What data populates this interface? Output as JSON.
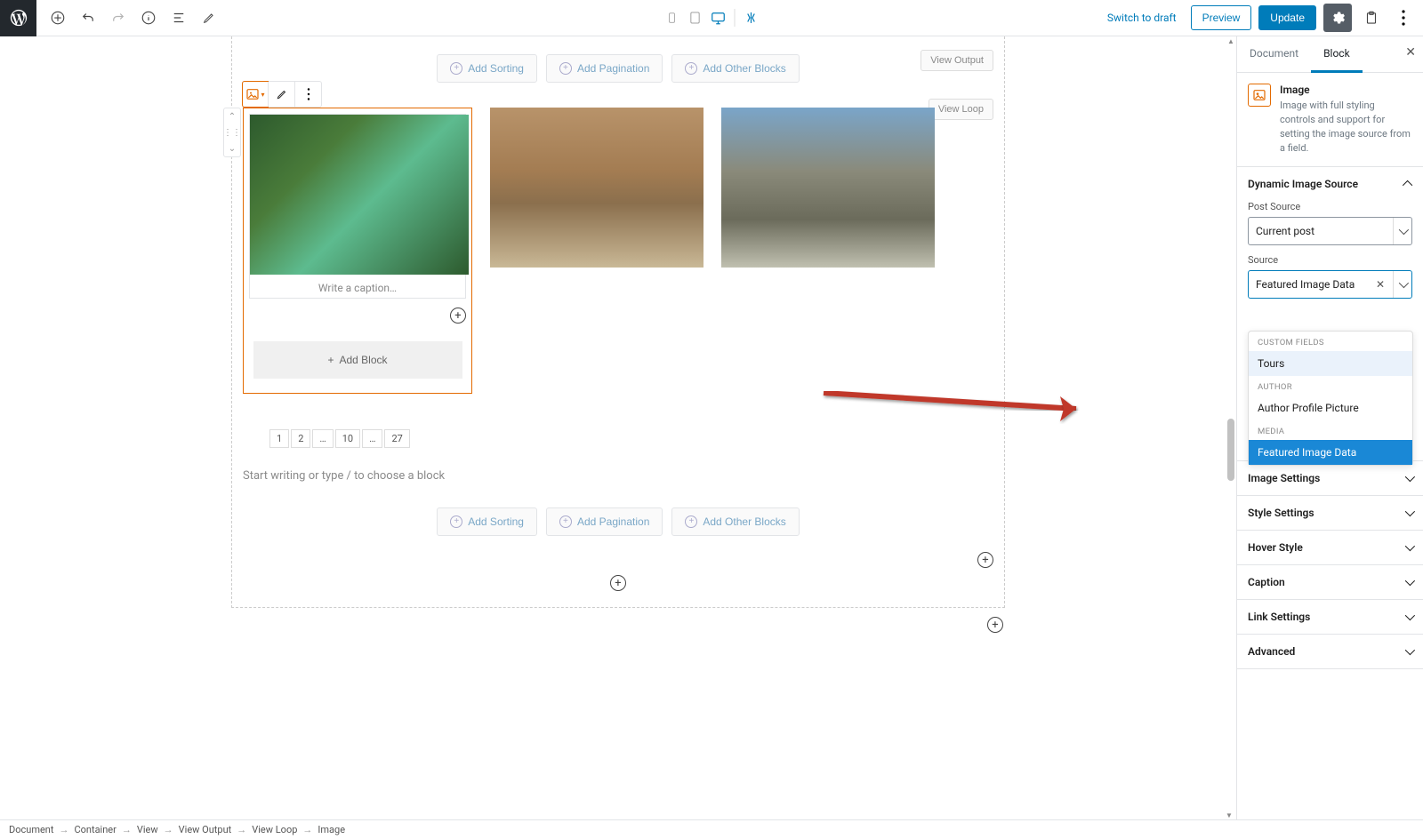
{
  "topbar": {
    "switch_draft": "Switch to draft",
    "preview": "Preview",
    "update": "Update"
  },
  "editor": {
    "buttons": {
      "sorting": "Add Sorting",
      "pagination": "Add Pagination",
      "other": "Add Other Blocks",
      "view_output": "View Output",
      "view_loop": "View Loop",
      "add_block": "Add Block"
    },
    "caption_placeholder": "Write a caption…",
    "pager": [
      "1",
      "2",
      "…",
      "10",
      "…",
      "27"
    ],
    "start_writing": "Start writing or type / to choose a block"
  },
  "sidebar": {
    "tabs": {
      "doc": "Document",
      "block": "Block"
    },
    "block": {
      "title": "Image",
      "desc": "Image with full styling controls and support for setting the image source from a field."
    },
    "panels": {
      "dynamic_src": "Dynamic Image Source",
      "post_source_label": "Post Source",
      "post_source_value": "Current post",
      "source_label": "Source",
      "source_value": "Featured Image Data",
      "dropdown": {
        "grp_custom": "CUSTOM FIELDS",
        "opt_tours": "Tours",
        "grp_author": "AUTHOR",
        "opt_author_pic": "Author Profile Picture",
        "grp_media": "MEDIA",
        "opt_featured": "Featured Image Data"
      },
      "image_settings": "Image Settings",
      "style_settings": "Style Settings",
      "hover_style": "Hover Style",
      "caption": "Caption",
      "link_settings": "Link Settings",
      "advanced": "Advanced"
    }
  },
  "breadcrumb": [
    "Document",
    "Container",
    "View",
    "View Output",
    "View Loop",
    "Image"
  ]
}
